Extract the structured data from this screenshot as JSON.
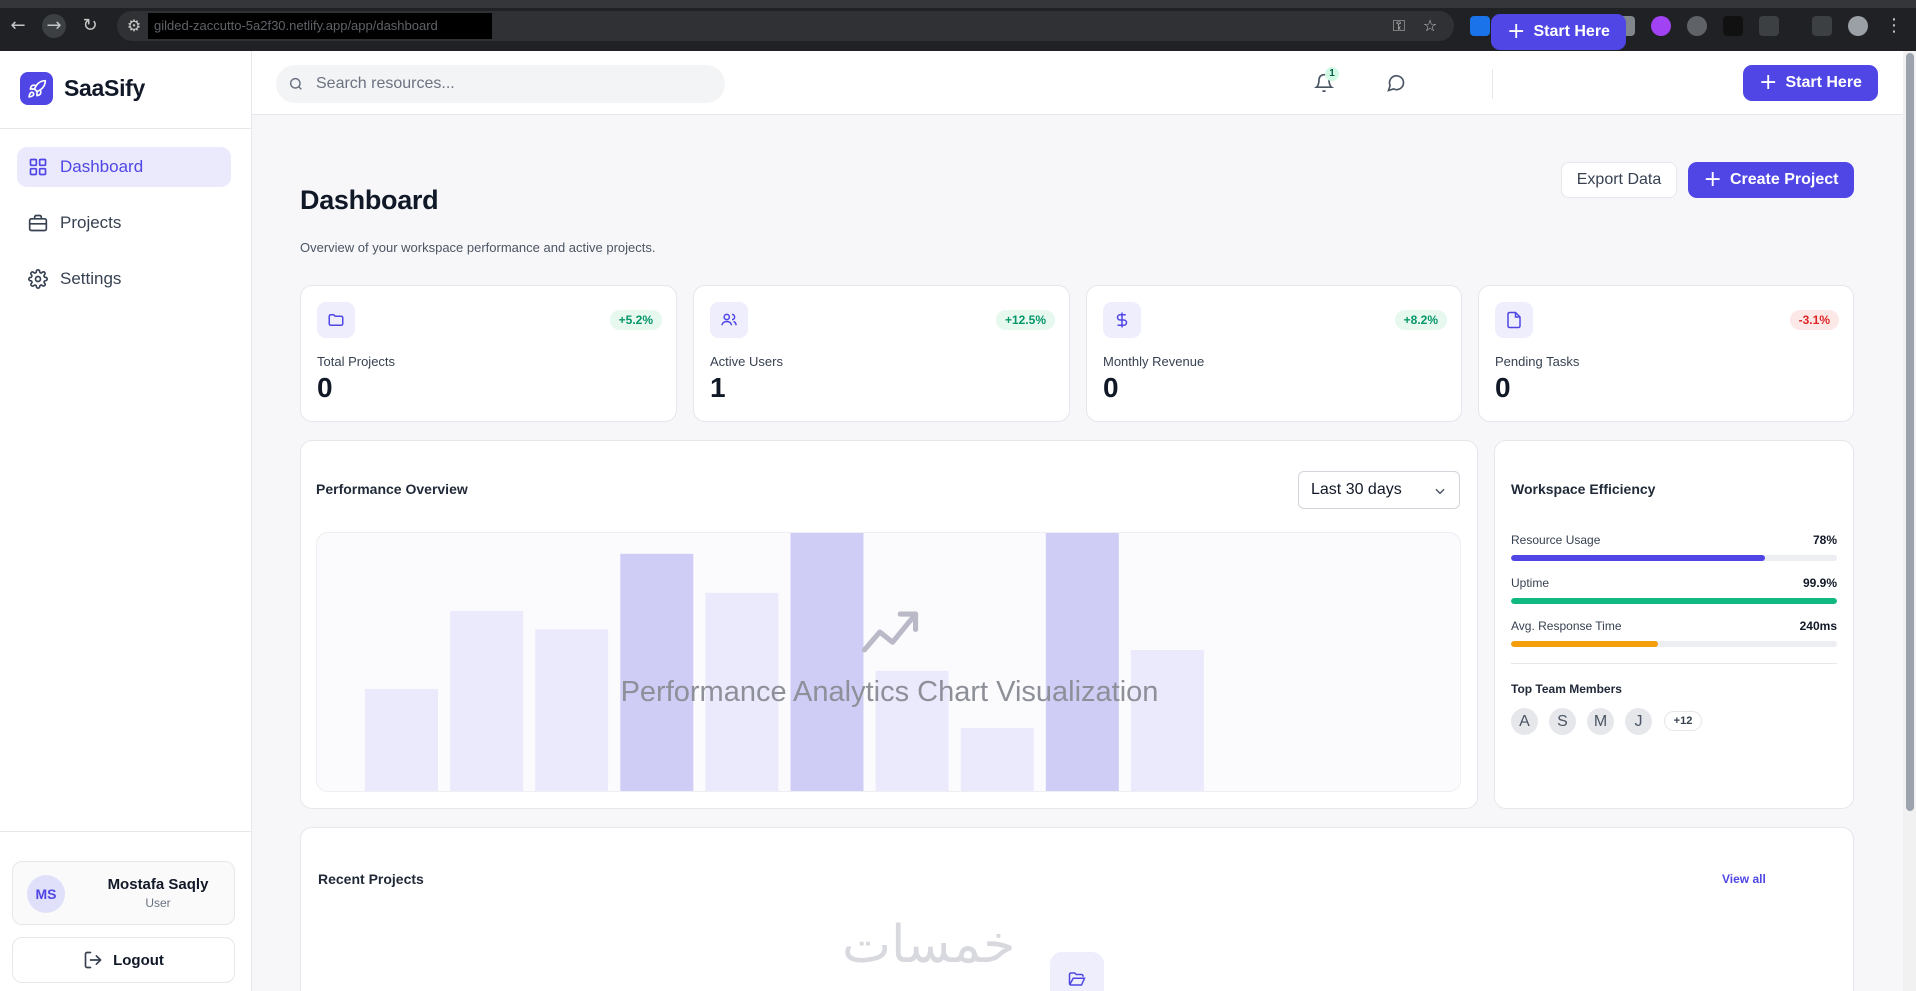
{
  "browser": {
    "url": "gilded-zaccutto-5a2f30.netlify.app/app/dashboard"
  },
  "brand": {
    "name": "SaaSify"
  },
  "sidebar": {
    "items": [
      {
        "label": "Dashboard",
        "active": true
      },
      {
        "label": "Projects",
        "active": false
      },
      {
        "label": "Settings",
        "active": false
      }
    ],
    "user": {
      "initials": "MS",
      "name": "Mostafa Saqly",
      "role": "User"
    },
    "logout_label": "Logout"
  },
  "header": {
    "search_placeholder": "Search resources...",
    "notification_count": "1",
    "start_label": "Start Here"
  },
  "page": {
    "title": "Dashboard",
    "subtitle": "Overview of your workspace performance and active projects.",
    "export_label": "Export Data",
    "create_label": "Create Project"
  },
  "stats": [
    {
      "label": "Total Projects",
      "value": "0",
      "change": "+5.2%",
      "trend": "up",
      "icon": "folder-icon"
    },
    {
      "label": "Active Users",
      "value": "1",
      "change": "+12.5%",
      "trend": "up",
      "icon": "users-icon"
    },
    {
      "label": "Monthly Revenue",
      "value": "0",
      "change": "+8.2%",
      "trend": "up",
      "icon": "dollar-icon"
    },
    {
      "label": "Pending Tasks",
      "value": "0",
      "change": "-3.1%",
      "trend": "down",
      "icon": "file-icon"
    }
  ],
  "performance": {
    "title": "Performance Overview",
    "range_selected": "Last 30 days",
    "chart_caption": "Performance Analytics Chart Visualization",
    "placeholder_bars": [
      40,
      70,
      63,
      92,
      77,
      100,
      47,
      25,
      100,
      55
    ],
    "highlighted_bars": [
      3,
      5,
      8
    ],
    "bar_color": "#ebeafc",
    "highlight_color": "#cfcdf5"
  },
  "efficiency": {
    "title": "Workspace Efficiency",
    "metrics": [
      {
        "label": "Resource Usage",
        "value": "78%",
        "fill": 0.78,
        "color": "#4f46e5"
      },
      {
        "label": "Uptime",
        "value": "99.9%",
        "fill": 0.999,
        "color": "#10b981"
      },
      {
        "label": "Avg. Response Time",
        "value": "240ms",
        "fill": 0.45,
        "color": "#f59e0b"
      }
    ],
    "team_title": "Top Team Members",
    "team": [
      "A",
      "S",
      "M",
      "J"
    ],
    "team_more": "+12"
  },
  "recent": {
    "title": "Recent Projects",
    "view_all": "View all"
  },
  "colors": {
    "accent": "#4f46e5",
    "success": "#10b981",
    "warning": "#f59e0b",
    "danger": "#dc2626"
  }
}
